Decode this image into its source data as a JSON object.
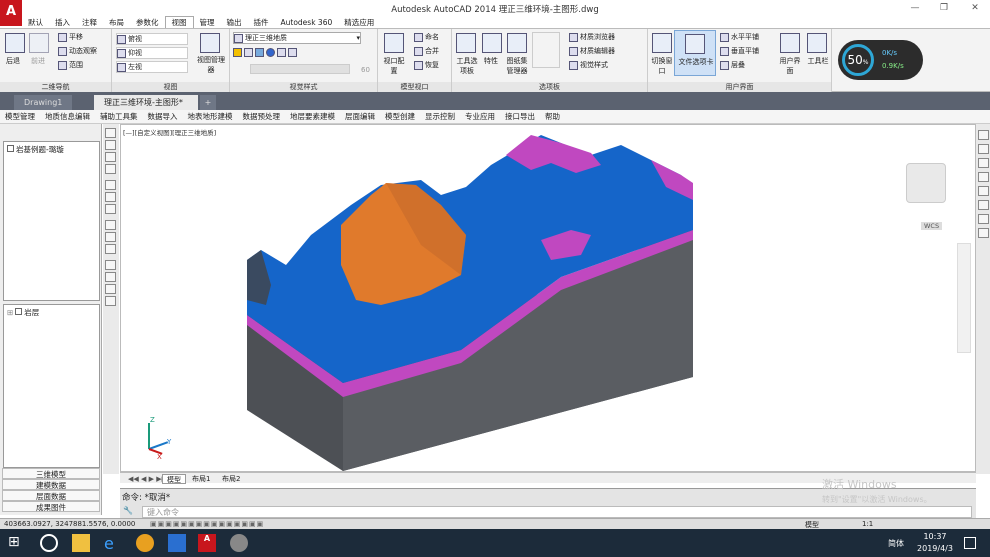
{
  "window": {
    "title": "Autodesk AutoCAD 2014    理正三维环境-主图形.dwg",
    "app_button": "A",
    "controls": [
      "—",
      "❐",
      "✕"
    ]
  },
  "ribbon_tabs": [
    "默认",
    "插入",
    "注释",
    "布局",
    "参数化",
    "视图",
    "管理",
    "输出",
    "插件",
    "Autodesk 360",
    "精选应用"
  ],
  "ribbon_active_tab": "视图",
  "ribbon": {
    "nav2d": {
      "title": "二维导航",
      "back": "后退",
      "forward": "前进",
      "pan": "平移",
      "orbit": "动态观察",
      "range": "范围"
    },
    "views": {
      "title": "视图",
      "items": [
        "俯视",
        "仰视",
        "左视"
      ],
      "manager": "视图管理器"
    },
    "visual": {
      "title": "视觉样式",
      "style_value": "理正三维地质",
      "slider_value": "60"
    },
    "model_viewport": {
      "title": "模型视口",
      "config": "视口配置",
      "name": "命名",
      "join": "合并",
      "restore": "恢复"
    },
    "palettes": {
      "title": "选项板",
      "tool": "工具选项板",
      "props": "特性",
      "sheetset": "图纸集管理器",
      "mat_browser": "材质浏览器",
      "mat_editor": "材质编辑器",
      "visual_styles": "视觉样式"
    },
    "ui": {
      "title": "用户界面",
      "switch_window": "切换窗口",
      "file_tabs": "文件选项卡",
      "tile_h": "水平平铺",
      "tile_v": "垂直平铺",
      "cascade": "层叠",
      "user_interface": "用户界面",
      "toolbars": "工具栏"
    },
    "gauge": {
      "percent": "50",
      "unit": "%",
      "up": "0K/s",
      "down": "0.9K/s"
    }
  },
  "doc_tabs": [
    "Drawing1",
    "理正三维环境-主图形*"
  ],
  "menu": [
    "模型管理",
    "地质信息编辑",
    "辅助工具集",
    "数据导入",
    "地表地形建模",
    "数据预处理",
    "地层要素建模",
    "层面编辑",
    "模型创建",
    "显示控制",
    "专业应用",
    "接口导出",
    "帮助"
  ],
  "left_panel": {
    "tree1": "岩基例题-璐璇",
    "tree2": "岩层",
    "tabs": [
      "三维模型",
      "建模数据",
      "层面数据",
      "成果图件"
    ]
  },
  "viewport": {
    "label": "[—][自定义视图][理正三维地质]",
    "wcs": "WCS",
    "axis_x": "X",
    "axis_y": "Y",
    "axis_z": "Z",
    "colors": {
      "blue": "#1565c9",
      "orange": "#e07a2c",
      "magenta": "#c048c0",
      "gray": "#56595e"
    }
  },
  "layout_tabs": [
    "模型",
    "布局1",
    "布局2"
  ],
  "command": {
    "line1": "命令: *取消*",
    "placeholder": "键入命令"
  },
  "status": {
    "coords": "403663.0927, 3247881.5576, 0.0000",
    "mode": "模型",
    "scale": "1:1"
  },
  "watermark": {
    "line1": "激活 Windows",
    "line2": "转到\"设置\"以激活 Windows。"
  },
  "taskbar": {
    "lang": "简体",
    "time": "10:37",
    "date": "2019/4/3"
  }
}
